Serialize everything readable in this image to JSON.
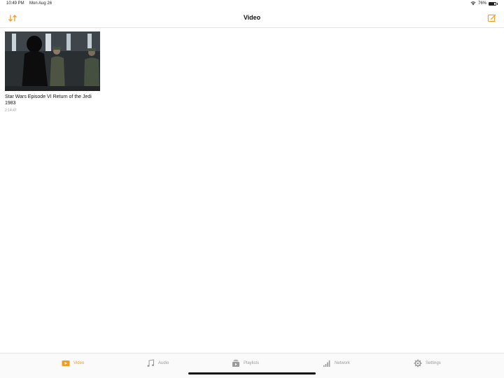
{
  "status": {
    "time": "10:49 PM",
    "date": "Mon Aug 26",
    "battery": "76%",
    "battery_level": 0.76
  },
  "nav": {
    "title": "Video",
    "sort_icon": "sort-icon",
    "edit_icon": "edit-icon"
  },
  "media": [
    {
      "title": "Star Wars Episode VI Return of the Jedi 1983",
      "duration": "2:14:47"
    }
  ],
  "tabs": [
    {
      "label": "Video",
      "icon": "video-icon",
      "active": true
    },
    {
      "label": "Audio",
      "icon": "music-note-icon",
      "active": false
    },
    {
      "label": "Playlists",
      "icon": "playlist-icon",
      "active": false
    },
    {
      "label": "Network",
      "icon": "network-icon",
      "active": false
    },
    {
      "label": "Settings",
      "icon": "gear-icon",
      "active": false
    }
  ],
  "colors": {
    "accent": "#f39c1c",
    "inactive": "#9a9a9a"
  }
}
